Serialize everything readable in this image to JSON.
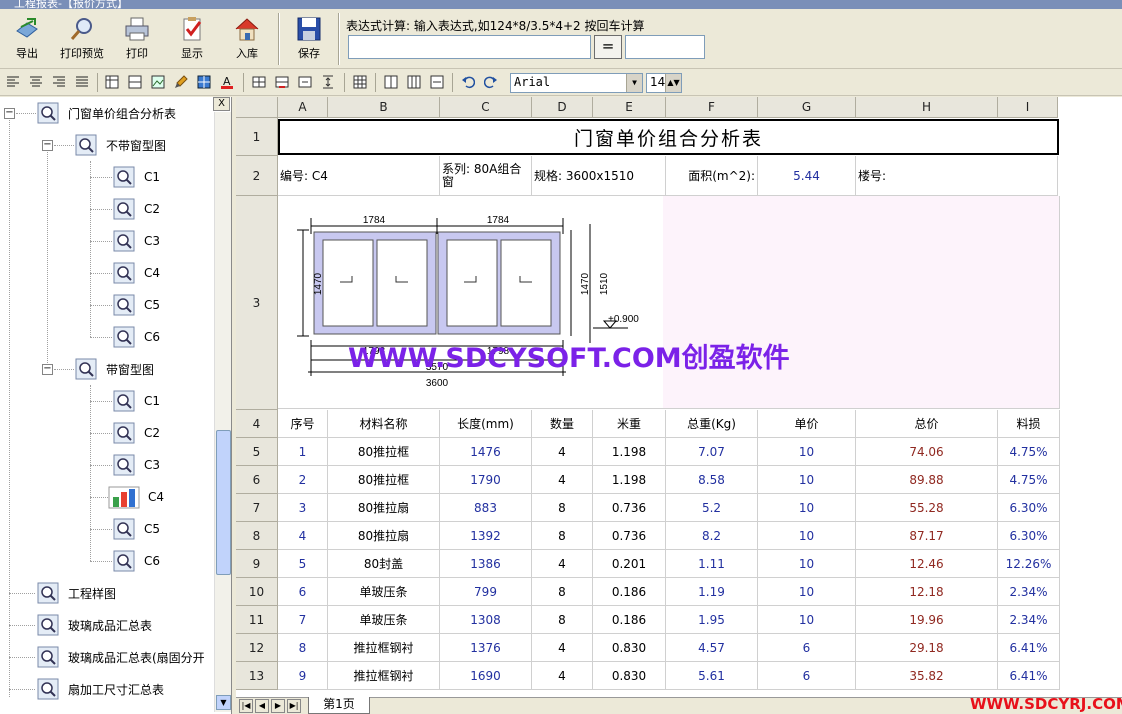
{
  "window": {
    "title": "工程报表-【报价方式】"
  },
  "toolbar": {
    "buttons": [
      {
        "label": "导出",
        "icon": "export-icon"
      },
      {
        "label": "打印预览",
        "icon": "print-preview-icon"
      },
      {
        "label": "打印",
        "icon": "printer-icon"
      },
      {
        "label": "显示",
        "icon": "show-icon"
      },
      {
        "label": "入库",
        "icon": "house-icon"
      },
      {
        "label": "保存",
        "icon": "save-icon"
      }
    ],
    "expression_label": "表达式计算: 输入表达式,如124*8/3.5*4+2 按回车计算",
    "expression_value": "",
    "equals_label": "=",
    "result_value": ""
  },
  "format_bar": {
    "font": "Arial",
    "size": "14"
  },
  "tree": {
    "root": {
      "label": "门窗单价组合分析表"
    },
    "groups": [
      {
        "label": "不带窗型图",
        "items": [
          "C1",
          "C2",
          "C3",
          "C4",
          "C5",
          "C6"
        ]
      },
      {
        "label": "带窗型图",
        "items": [
          "C1",
          "C2",
          "C3",
          "C4",
          "C5",
          "C6"
        ],
        "selected": "C4"
      }
    ],
    "others": [
      "工程样图",
      "玻璃成品汇总表",
      "玻璃成品汇总表(扇固分开",
      "扇加工尺寸汇总表"
    ],
    "close_label": "X"
  },
  "sheet": {
    "columns": [
      "A",
      "B",
      "C",
      "D",
      "E",
      "F",
      "G",
      "H",
      "I"
    ],
    "row_numbers": [
      "1",
      "2",
      "3",
      "4",
      "5",
      "6",
      "7",
      "8",
      "9",
      "10",
      "11",
      "12",
      "13"
    ],
    "title": "门窗单价组合分析表",
    "info": {
      "code": "编号: C4",
      "series": "系列: 80A组合窗",
      "spec": "规格: 3600x1510",
      "area_label": "面积(m^2):",
      "area_value": "5.44",
      "building": "楼号:"
    },
    "drawing": {
      "dim_top_left": "1784",
      "dim_top_right": "1784",
      "dim_left": "1470",
      "dim_right_inner": "1470",
      "dim_right_outer": "1510",
      "level": "+0.900",
      "dim_inner": "1798",
      "dim_inner2": "1798",
      "dim_mid": "3570",
      "dim_bottom": "3600"
    },
    "watermark": "WWW.SDCYSOFT.COM创盈软件",
    "headers": [
      "序号",
      "材料名称",
      "长度(mm)",
      "数量",
      "米重",
      "总重(Kg)",
      "单价",
      "总价",
      "料损"
    ],
    "rows": [
      [
        "1",
        "80推拉框",
        "1476",
        "4",
        "1.198",
        "7.07",
        "10",
        "74.06",
        "4.75%"
      ],
      [
        "2",
        "80推拉框",
        "1790",
        "4",
        "1.198",
        "8.58",
        "10",
        "89.88",
        "4.75%"
      ],
      [
        "3",
        "80推拉扇",
        "883",
        "8",
        "0.736",
        "5.2",
        "10",
        "55.28",
        "6.30%"
      ],
      [
        "4",
        "80推拉扇",
        "1392",
        "8",
        "0.736",
        "8.2",
        "10",
        "87.17",
        "6.30%"
      ],
      [
        "5",
        "80封盖",
        "1386",
        "4",
        "0.201",
        "1.11",
        "10",
        "12.46",
        "12.26%"
      ],
      [
        "6",
        "单玻压条",
        "799",
        "8",
        "0.186",
        "1.19",
        "10",
        "12.18",
        "2.34%"
      ],
      [
        "7",
        "单玻压条",
        "1308",
        "8",
        "0.186",
        "1.95",
        "10",
        "19.96",
        "2.34%"
      ],
      [
        "8",
        "推拉框钢衬",
        "1376",
        "4",
        "0.830",
        "4.57",
        "6",
        "29.18",
        "6.41%"
      ],
      [
        "9",
        "推拉框钢衬",
        "1690",
        "4",
        "0.830",
        "5.61",
        "6",
        "35.82",
        "6.41%"
      ]
    ]
  },
  "tabs": {
    "sheet1": "第1页"
  },
  "brand": "WWW.SDCYRJ.COM"
}
